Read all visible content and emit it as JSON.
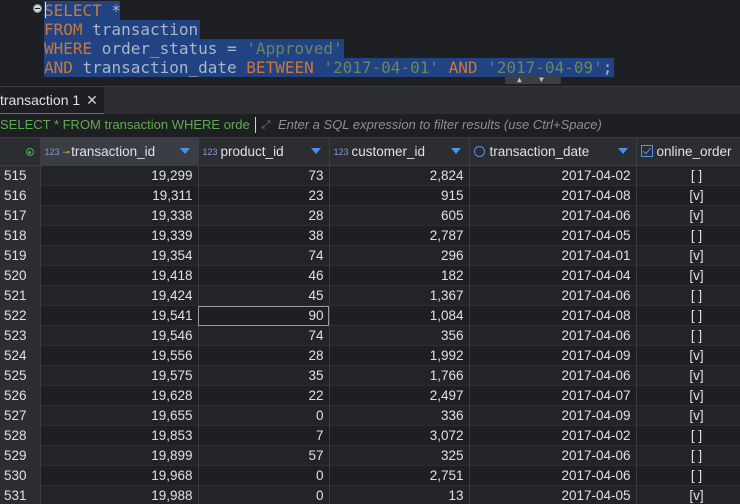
{
  "editor": {
    "lines": [
      {
        "kw1": "SELECT",
        "rest": " *"
      },
      {
        "kw1": "FROM",
        "rest": " transaction"
      },
      {
        "kw1": "WHERE",
        "ident": " order_status",
        "op": " = ",
        "str": "'Approved'"
      },
      {
        "kw1": "AND",
        "ident": " transaction_date ",
        "kw2": "BETWEEN",
        "str1": " '2017-04-01'",
        "kw3": " AND",
        "str2": " '2017-04-09'",
        "end": ";"
      }
    ]
  },
  "result_tab": {
    "label": "transaction 1",
    "close": "✕"
  },
  "filter": {
    "current_sql": "SELECT * FROM transaction WHERE orde",
    "placeholder": "Enter a SQL expression to filter results (use Ctrl+Space)"
  },
  "grid": {
    "type_badge": "123",
    "columns": [
      "transaction_id",
      "product_id",
      "customer_id",
      "transaction_date",
      "online_order"
    ],
    "rows": [
      [
        "515",
        "19,299",
        "73",
        "2,824",
        "2017-04-02",
        "[ ]"
      ],
      [
        "516",
        "19,311",
        "23",
        "915",
        "2017-04-08",
        "[v]"
      ],
      [
        "517",
        "19,338",
        "28",
        "605",
        "2017-04-06",
        "[v]"
      ],
      [
        "518",
        "19,339",
        "38",
        "2,787",
        "2017-04-05",
        "[ ]"
      ],
      [
        "519",
        "19,354",
        "74",
        "296",
        "2017-04-01",
        "[v]"
      ],
      [
        "520",
        "19,418",
        "46",
        "182",
        "2017-04-04",
        "[v]"
      ],
      [
        "521",
        "19,424",
        "45",
        "1,367",
        "2017-04-06",
        "[ ]"
      ],
      [
        "522",
        "19,541",
        "90",
        "1,084",
        "2017-04-08",
        "[ ]"
      ],
      [
        "523",
        "19,546",
        "74",
        "356",
        "2017-04-06",
        "[ ]"
      ],
      [
        "524",
        "19,556",
        "28",
        "1,992",
        "2017-04-09",
        "[v]"
      ],
      [
        "525",
        "19,575",
        "35",
        "1,766",
        "2017-04-06",
        "[v]"
      ],
      [
        "526",
        "19,628",
        "22",
        "2,497",
        "2017-04-07",
        "[v]"
      ],
      [
        "527",
        "19,655",
        "0",
        "336",
        "2017-04-09",
        "[v]"
      ],
      [
        "528",
        "19,853",
        "7",
        "3,072",
        "2017-04-02",
        "[ ]"
      ],
      [
        "529",
        "19,899",
        "57",
        "325",
        "2017-04-06",
        "[ ]"
      ],
      [
        "530",
        "19,968",
        "0",
        "2,751",
        "2017-04-06",
        "[ ]"
      ],
      [
        "531",
        "19,988",
        "0",
        "13",
        "2017-04-05",
        "[v]"
      ]
    ]
  }
}
